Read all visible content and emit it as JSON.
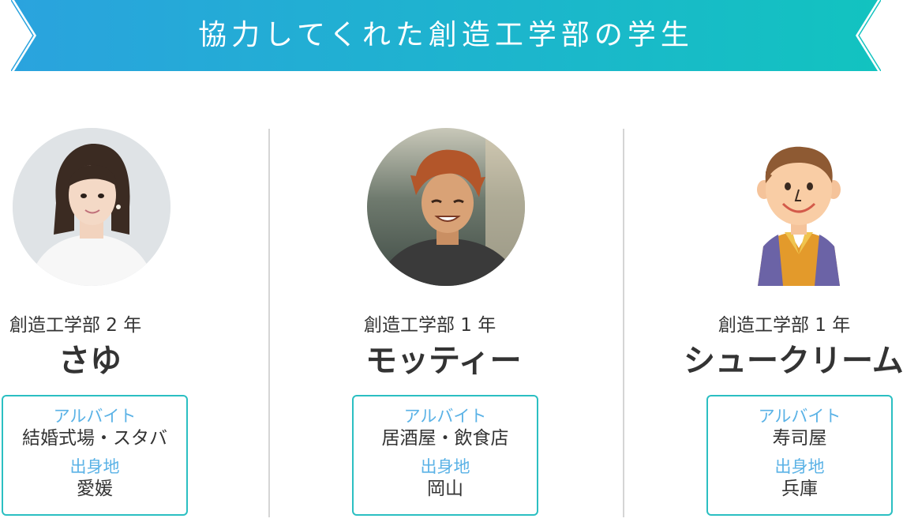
{
  "banner": {
    "title": "協力してくれた創造工学部の学生",
    "gradient_start": "#2aa3de",
    "gradient_end": "#12c3c0"
  },
  "students": [
    {
      "grade": "創造工学部 2 年",
      "name": "さゆ",
      "job_label": "アルバイト",
      "job": "結婚式場・スタバ",
      "hometown_label": "出身地",
      "hometown": "愛媛"
    },
    {
      "grade": "創造工学部 1 年",
      "name": "モッティー",
      "job_label": "アルバイト",
      "job": "居酒屋・飲食店",
      "hometown_label": "出身地",
      "hometown": "岡山"
    },
    {
      "grade": "創造工学部 1 年",
      "name": "シュークリーム",
      "job_label": "アルバイト",
      "job": "寿司屋",
      "hometown_label": "出身地",
      "hometown": "兵庫"
    }
  ],
  "colors": {
    "box_border": "#2bbfc2",
    "label": "#5ab2e6",
    "text": "#333333",
    "divider": "#d5d5d5"
  }
}
